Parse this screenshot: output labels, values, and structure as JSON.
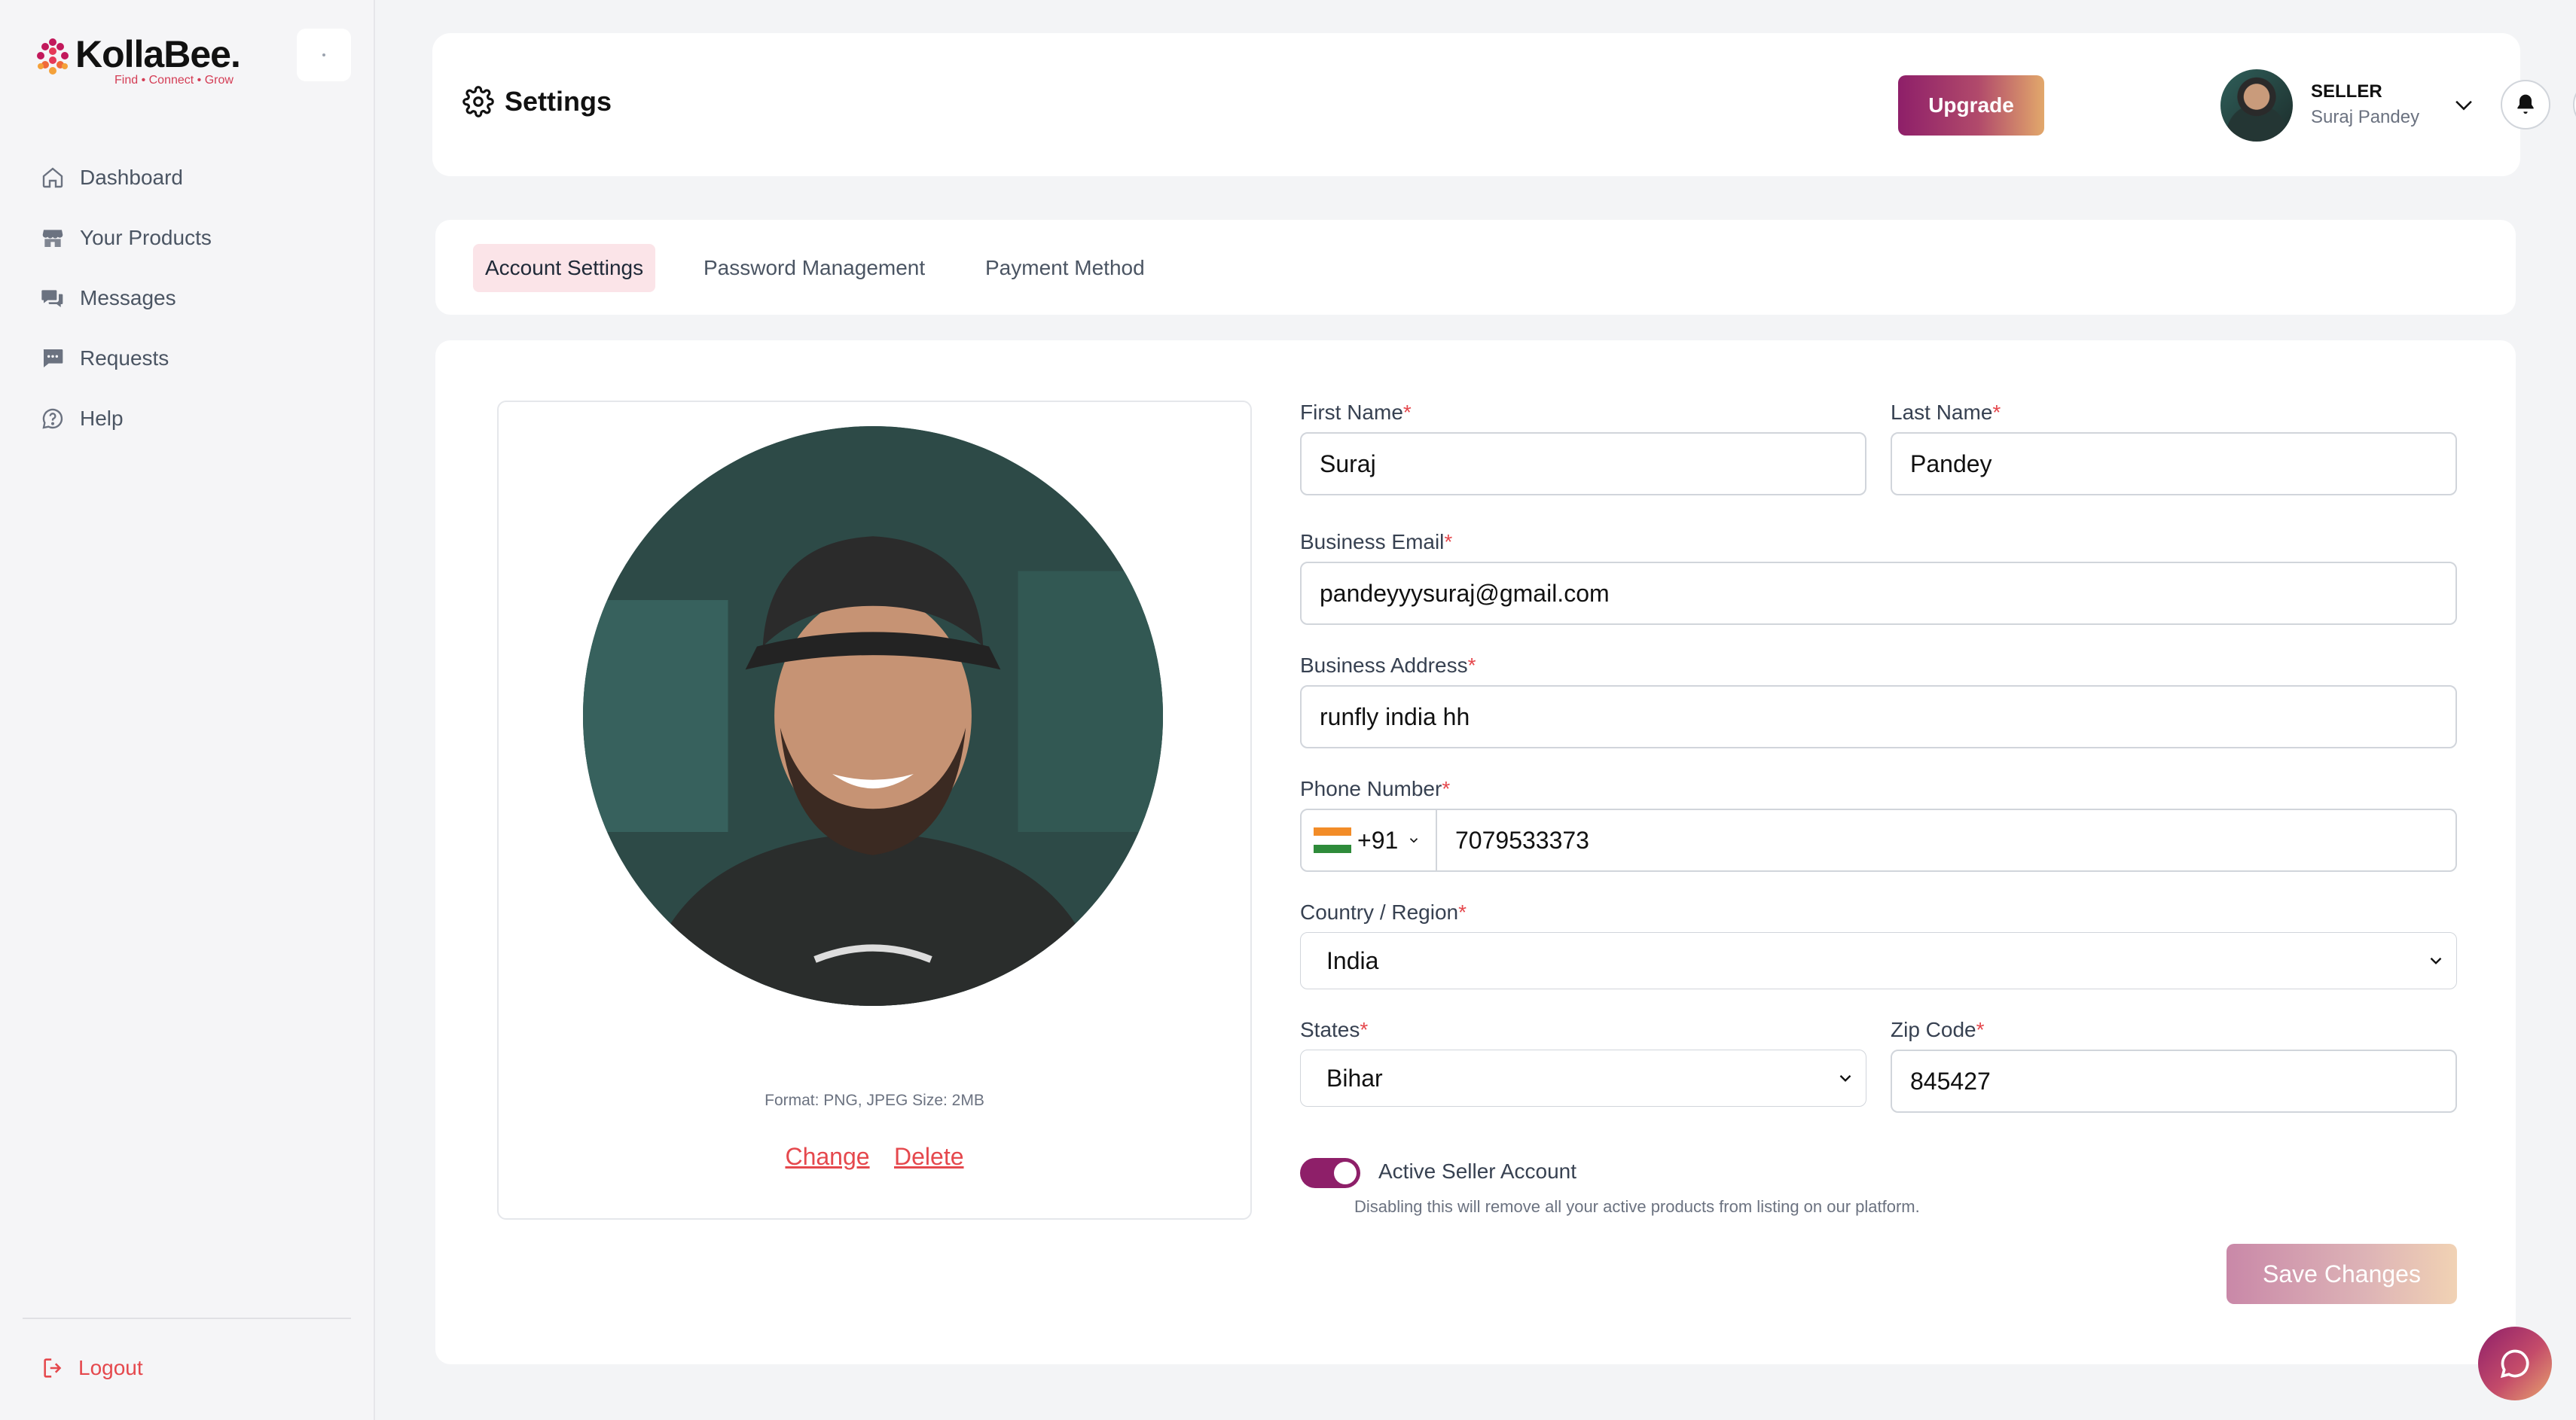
{
  "app": {
    "logo_name": "KollaBee.",
    "logo_tagline": "Find • Connect • Grow"
  },
  "sidebar": {
    "items": [
      {
        "label": "Dashboard",
        "icon": "home-icon"
      },
      {
        "label": "Your Products",
        "icon": "store-icon"
      },
      {
        "label": "Messages",
        "icon": "chat-bubbles-icon"
      },
      {
        "label": "Requests",
        "icon": "message-square-icon"
      },
      {
        "label": "Help",
        "icon": "help-circle-icon"
      }
    ],
    "logout_label": "Logout"
  },
  "header": {
    "title": "Settings",
    "upgrade_label": "Upgrade",
    "user_role": "SELLER",
    "user_name": "Suraj Pandey"
  },
  "tabs": [
    {
      "label": "Account Settings",
      "active": true
    },
    {
      "label": "Password Management",
      "active": false
    },
    {
      "label": "Payment Method",
      "active": false
    }
  ],
  "profile": {
    "format_note": "Format: PNG, JPEG Size: 2MB",
    "change_label": "Change",
    "delete_label": "Delete"
  },
  "form": {
    "first_name": {
      "label": "First Name",
      "value": "Suraj"
    },
    "last_name": {
      "label": "Last Name",
      "value": "Pandey"
    },
    "business_email": {
      "label": "Business Email",
      "value": "pandeyyysuraj@gmail.com"
    },
    "business_address": {
      "label": "Business Address",
      "value": "runfly india hh"
    },
    "phone": {
      "label": "Phone Number",
      "country_code": "+91",
      "value": "7079533373"
    },
    "country": {
      "label": "Country / Region",
      "value": "India"
    },
    "state": {
      "label": "States",
      "value": "Bihar"
    },
    "zip": {
      "label": "Zip Code",
      "value": "845427"
    },
    "required_marker": "*",
    "active_seller": {
      "label": "Active Seller Account",
      "enabled": true,
      "hint": "Disabling this will remove all your active products from listing on our platform."
    },
    "save_label": "Save Changes"
  },
  "colors": {
    "accent": "#8e1f69",
    "danger": "#e5484d",
    "tab_active_bg": "#fbe4e8"
  }
}
